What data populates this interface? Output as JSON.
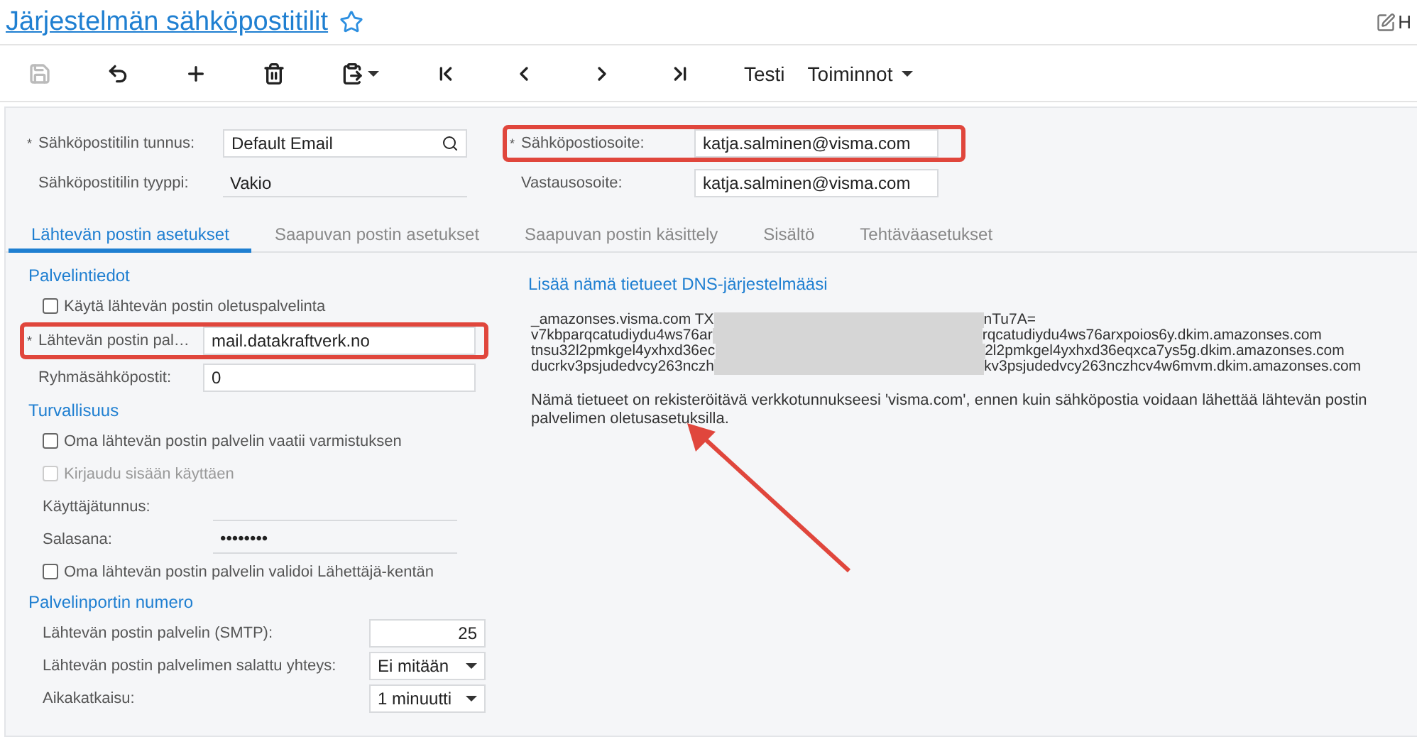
{
  "header": {
    "title": "Järjestelmän sähköpostitilit",
    "favorite": false,
    "right_text": "H"
  },
  "toolbar": [
    {
      "kind": "icon",
      "disabled": true
    },
    {
      "kind": "icon",
      "disabled": false
    },
    {
      "kind": "icon",
      "disabled": false
    },
    {
      "kind": "icon",
      "disabled": false
    },
    {
      "kind": "menu-icon",
      "disabled": false
    },
    {
      "kind": "icon",
      "disabled": false
    },
    {
      "kind": "icon",
      "disabled": false
    },
    {
      "kind": "icon",
      "disabled": false
    },
    {
      "kind": "icon",
      "disabled": false
    },
    {
      "kind": "text",
      "label": "Testi"
    },
    {
      "kind": "menu",
      "label": "Toiminnot"
    }
  ],
  "summary": {
    "left": [
      {
        "kind": "lookup",
        "label": "Sähköpostitilin tunnus:",
        "required": true,
        "marker": "*",
        "value": "Default Email",
        "highlighted": false
      },
      {
        "kind": "static",
        "label": "Sähköpostitilin tyyppi:",
        "required": false,
        "value": "Vakio",
        "highlighted": false
      }
    ],
    "right": [
      {
        "kind": "input",
        "label": "Sähköpostiosoite:",
        "required": true,
        "marker": "*",
        "value": "katja.salminen@visma.com",
        "highlighted": true
      },
      {
        "kind": "input",
        "label": "Vastausosoite:",
        "required": false,
        "value": "katja.salminen@visma.com",
        "highlighted": false
      }
    ]
  },
  "tabs": [
    {
      "label": "Lähtevän postin asetukset",
      "selected": true
    },
    {
      "label": "Saapuvan postin asetukset",
      "selected": false
    },
    {
      "label": "Saapuvan postin käsittely",
      "selected": false
    },
    {
      "label": "Sisältö",
      "selected": false
    },
    {
      "label": "Tehtäväasetukset",
      "selected": false
    }
  ],
  "sections": [
    {
      "title": "Palvelintiedot",
      "rows": [
        {
          "kind": "checkbox",
          "label": "Käytä lähtevän postin oletuspalvelinta",
          "checked": false,
          "disabled": false
        },
        {
          "kind": "input",
          "label": "Lähtevän postin pal…",
          "required": true,
          "marker": "*",
          "value": "mail.datakraftverk.no",
          "highlighted": true
        },
        {
          "kind": "input",
          "label": "Ryhmäsähköpostit:",
          "required": false,
          "value": "0",
          "highlighted": false
        }
      ]
    },
    {
      "title": "Turvallisuus",
      "rows": [
        {
          "kind": "checkbox",
          "label": "Oma lähtevän postin palvelin vaatii varmistuksen",
          "checked": false,
          "disabled": false
        },
        {
          "kind": "checkbox",
          "label": "Kirjaudu sisään käyttäen",
          "checked": false,
          "disabled": true
        },
        {
          "kind": "line",
          "label": "Käyttäjätunnus:"
        },
        {
          "kind": "line",
          "label": "Salasana:",
          "value": "••••••••"
        },
        {
          "kind": "checkbox",
          "label": "Oma lähtevän postin palvelin validoi Lähettäjä-kentän",
          "checked": false,
          "disabled": false
        }
      ]
    },
    {
      "title": "Palvelinportin numero",
      "rows": [
        {
          "kind": "number",
          "label": "Lähtevän postin palvelin (SMTP):",
          "value": "25"
        },
        {
          "kind": "select",
          "label": "Lähtevän postin palvelimen salattu yhteys:",
          "value": "Ei mitään"
        },
        {
          "kind": "select",
          "label": "Aikakatkaisu:",
          "value": "1 minuutti"
        }
      ]
    }
  ],
  "dns": {
    "title": "Lisää nämä tietueet DNS-järjestelmääsi",
    "records": [
      {
        "start": "_amazonses.visma.com TX",
        "end": "nTu7A="
      },
      {
        "start": "v7kbparqcatudiydu4ws76ar",
        "end": "rqcatudiydu4ws76arxpoios6y.dkim.amazonses.com"
      },
      {
        "start": "tnsu32l2pmkgel4yxhxd36ec",
        "end": "2l2pmkgel4yxhxd36eqxca7ys5g.dkim.amazonses.com"
      },
      {
        "start": "ducrkv3psjudedvcy263nczh",
        "end": "kv3psjudedvcy263nczhcv4w6mvm.dkim.amazonses.com"
      }
    ],
    "note": "Nämä tietueet on rekisteröitävä verkkotunnukseesi 'visma.com', ennen kuin sähköpostia voidaan lähettää lähtevän postin palvelimen oletusasetuksilla.",
    "annotation_arrow": true
  }
}
